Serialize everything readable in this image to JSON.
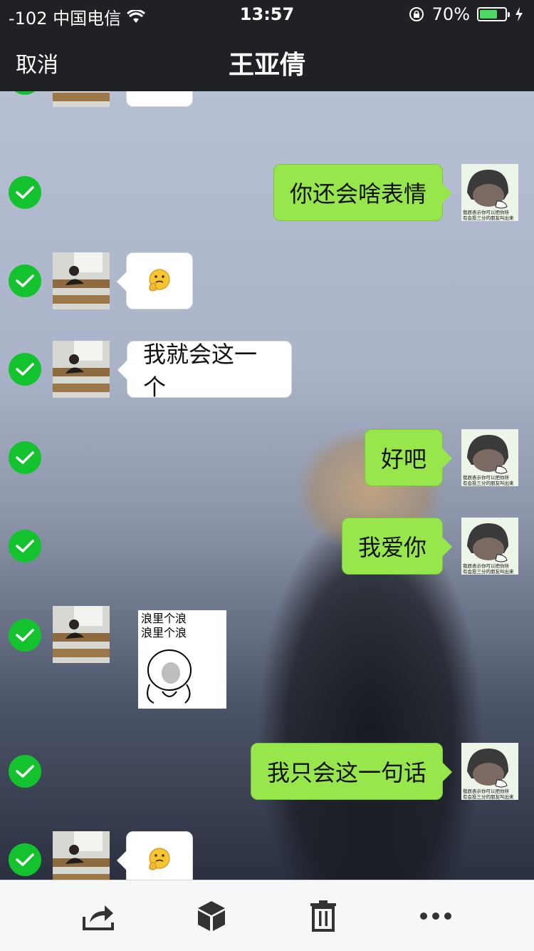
{
  "status_bar": {
    "carrier": "-102 中国电信",
    "time": "13:57",
    "battery_percent": "70%",
    "battery_level": 0.7,
    "icons": [
      "wifi-icon",
      "rotation-lock-icon",
      "battery-icon",
      "charging-icon"
    ]
  },
  "nav": {
    "cancel_label": "取消",
    "title": "王亚倩"
  },
  "colors": {
    "check": "#13c32e",
    "green_bubble": "#97e64c",
    "white_bubble": "#ffffff",
    "bar": "#202124"
  },
  "messages": [
    {
      "side": "left",
      "type": "emoji",
      "emoji": "🤔",
      "selected": true
    },
    {
      "side": "right",
      "type": "text",
      "text": "你还会啥表情",
      "selected": true
    },
    {
      "side": "left",
      "type": "emoji",
      "emoji": "🤔",
      "selected": true
    },
    {
      "side": "left",
      "type": "text",
      "text": "我就会这一个",
      "selected": true
    },
    {
      "side": "right",
      "type": "text",
      "text": "好吧",
      "selected": true
    },
    {
      "side": "right",
      "type": "text",
      "text": "我爱你",
      "selected": true
    },
    {
      "side": "left",
      "type": "sticker",
      "sticker_lines": [
        "浪里个浪",
        "浪里个浪"
      ],
      "selected": true
    },
    {
      "side": "right",
      "type": "text",
      "text": "我只会这一句话",
      "selected": true
    },
    {
      "side": "left",
      "type": "emoji",
      "emoji": "🤔",
      "selected": true
    }
  ],
  "avatar_right_caption": [
    "我辰表示你可以把你所",
    "有会投三分的朋友叫出来"
  ],
  "toolbar": {
    "items": [
      "share-icon",
      "favorite-box-icon",
      "delete-trash-icon",
      "more-icon"
    ]
  }
}
